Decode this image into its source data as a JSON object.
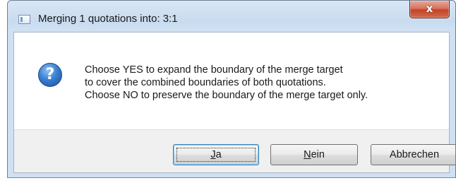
{
  "window": {
    "title": "Merging 1 quotations into: 3:1",
    "close_glyph": "x"
  },
  "icons": {
    "title_icon": "window-icon",
    "message_icon": "question-icon",
    "message_icon_glyph": "?"
  },
  "message": {
    "lines": [
      "Choose YES to expand the boundary of the merge target",
      "to cover the combined boundaries of both quotations.",
      "Choose NO to preserve the boundary of the merge target only."
    ]
  },
  "buttons": {
    "yes_label": "Ja",
    "no_label": "Nein",
    "cancel_label": "Abbrechen"
  },
  "colors": {
    "close_button": "#c4432a",
    "default_button_border": "#3c7fb1",
    "question_icon": "#3a7fd0"
  }
}
